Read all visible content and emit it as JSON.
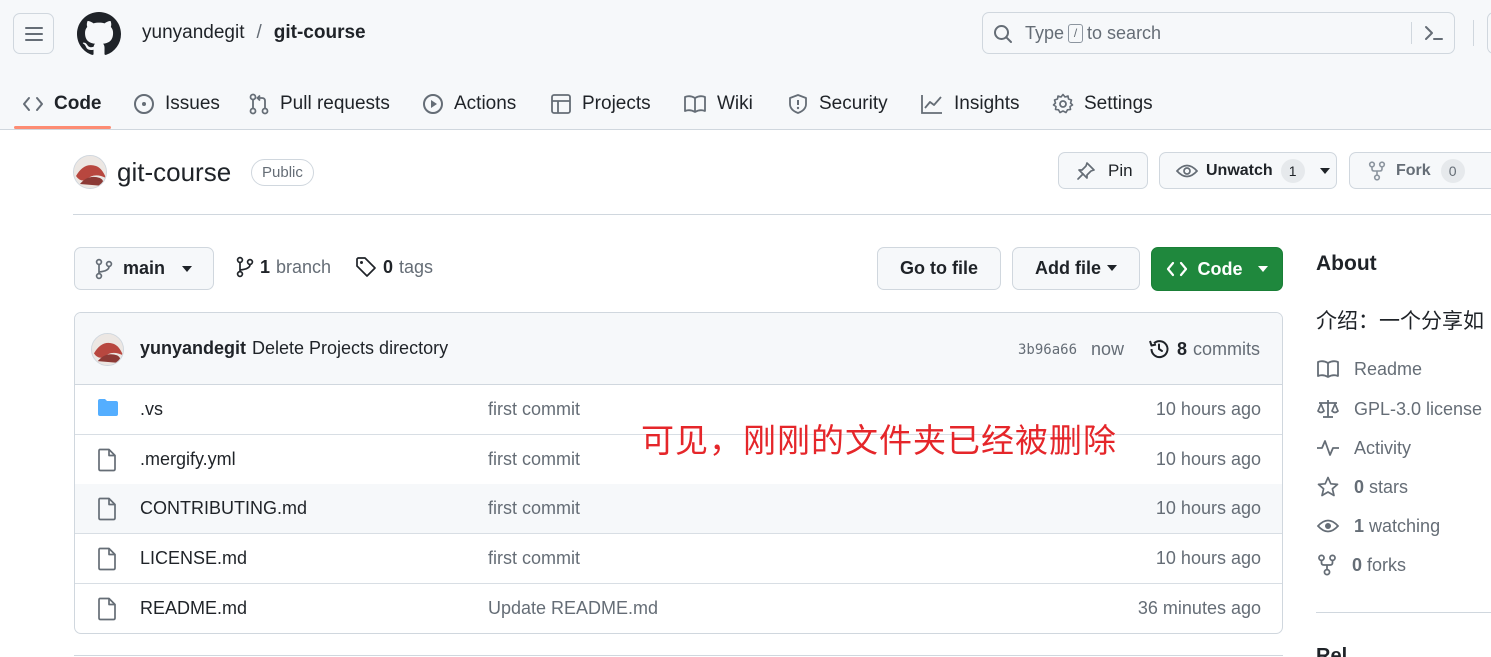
{
  "header": {
    "owner": "yunyandegit",
    "separator": "/",
    "repo": "git-course",
    "search_prefix": "Type",
    "search_key": "/",
    "search_suffix": "to search"
  },
  "tabs": [
    {
      "label": "Code",
      "icon": "code-icon",
      "active": true
    },
    {
      "label": "Issues",
      "icon": "issue-opened-icon"
    },
    {
      "label": "Pull requests",
      "icon": "git-pull-request-icon"
    },
    {
      "label": "Actions",
      "icon": "play-icon"
    },
    {
      "label": "Projects",
      "icon": "table-icon"
    },
    {
      "label": "Wiki",
      "icon": "book-icon"
    },
    {
      "label": "Security",
      "icon": "shield-icon"
    },
    {
      "label": "Insights",
      "icon": "graph-icon"
    },
    {
      "label": "Settings",
      "icon": "gear-icon"
    }
  ],
  "repo": {
    "name": "git-course",
    "visibility": "Public",
    "pin_label": "Pin",
    "unwatch_label": "Unwatch",
    "watch_count": "1",
    "fork_label": "Fork",
    "fork_count": "0"
  },
  "filenav": {
    "branch": "main",
    "branch_count": "1",
    "branch_label": "branch",
    "tag_count": "0",
    "tag_label": "tags",
    "goto_label": "Go to file",
    "addfile_label": "Add file",
    "code_label": "Code"
  },
  "latest_commit": {
    "author": "yunyandegit",
    "message": "Delete Projects directory",
    "hash": "3b96a66",
    "time": "now",
    "count": "8",
    "count_label": "commits"
  },
  "files": [
    {
      "name": ".vs",
      "type": "folder",
      "commit": "first commit",
      "time": "10 hours ago"
    },
    {
      "name": ".mergify.yml",
      "type": "file",
      "commit": "first commit",
      "time": "10 hours ago"
    },
    {
      "name": "CONTRIBUTING.md",
      "type": "file",
      "commit": "first commit",
      "time": "10 hours ago"
    },
    {
      "name": "LICENSE.md",
      "type": "file",
      "commit": "first commit",
      "time": "10 hours ago"
    },
    {
      "name": "README.md",
      "type": "file",
      "commit": "Update README.md",
      "time": "36 minutes ago"
    }
  ],
  "annotation": "可见，刚刚的文件夹已经被删除",
  "about": {
    "title": "About",
    "description": "介绍：一个分享如",
    "readme": "Readme",
    "license": "GPL-3.0 license",
    "activity": "Activity",
    "stars_count": "0",
    "stars_label": "stars",
    "watching_count": "1",
    "watching_label": "watching",
    "forks_count": "0",
    "forks_label": "forks",
    "next_section": "Rel"
  },
  "colors": {
    "accent_green": "#1f883d",
    "tab_underline": "#fd8c73",
    "annotation_red": "#e5262a",
    "folder_blue": "#54aeff"
  }
}
